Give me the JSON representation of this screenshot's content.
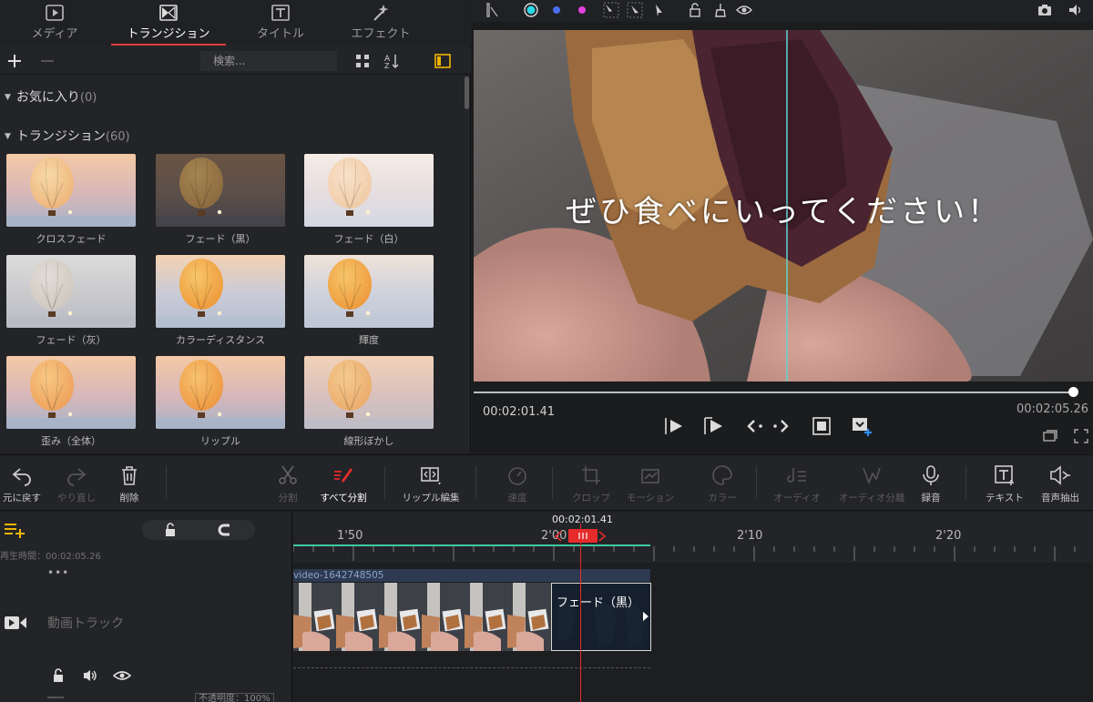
{
  "library": {
    "tabs": [
      {
        "label": "メディア",
        "icon": "media-icon"
      },
      {
        "label": "トランジション",
        "icon": "transition-icon",
        "active": true
      },
      {
        "label": "タイトル",
        "icon": "title-icon"
      },
      {
        "label": "エフェクト",
        "icon": "effect-icon"
      }
    ],
    "search_placeholder": "検索...",
    "categories": [
      {
        "name": "お気に入り",
        "count": "(0)"
      },
      {
        "name": "トランジション",
        "count": "(60)"
      }
    ],
    "items": [
      "クロスフェード",
      "フェード（黒）",
      "フェード（白）",
      "フェード（灰）",
      "カラーディスタンス",
      "輝度",
      "歪み（全体）",
      "リップル",
      "線形ぼかし"
    ]
  },
  "preview": {
    "subtitle": "ぜひ食べにいってください！",
    "current_time": "00:02:01.41",
    "total_time": "00:02:05.26",
    "seek_progress": 0.997
  },
  "edit_toolbar": {
    "undo": "元に戻す",
    "redo": "やり直し",
    "delete": "削除",
    "split": "分割",
    "split_all": "すべて分割",
    "ripple_edit": "リップル編集",
    "speed": "速度",
    "crop": "クロップ",
    "motion": "モーション",
    "color": "カラー",
    "audio": "オーディオ",
    "audio_split": "オーディオ分離",
    "record": "録音",
    "text": "テキスト",
    "audio_extract": "音声抽出"
  },
  "timeline": {
    "playhead_time": "00:02:01.41",
    "ruler_labels": [
      "1'50",
      "2'00",
      "2'10",
      "2'20"
    ],
    "duration_label": "再生時間：00:02:05.26",
    "more": "•••",
    "track_label": "動画トラック",
    "clip_name": "video-1642748505",
    "transition_label": "フェード（黒）",
    "opacity_label": "不透明度：100%"
  },
  "colors": {
    "accent_red": "#e52b2b",
    "accent_green": "#3fc7a3",
    "accent_yellow": "#f0b400"
  }
}
